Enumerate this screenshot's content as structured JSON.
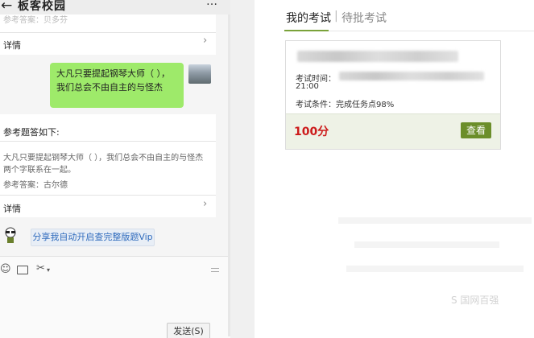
{
  "chat": {
    "back_icon": "←",
    "title": "板客校园",
    "more_icon": "…",
    "top_reference_faded": "参考答案：贝多芬",
    "details_label_1": "详情",
    "chevron_icon": "›",
    "bubble_text": "大凡只要提起钢琴大师（ ），我们总会不由自主的与怪杰",
    "reference_heading": "参考题答如下:",
    "question_text": "大凡只要提起钢琴大师（ ），我们总会不由自主的与怪杰两个字联系在一起。",
    "reference_answer": "参考答案：古尔德",
    "details_label_2": "详情",
    "share_label": "分享我自动开启查完整版题Vip",
    "toolbar_icons": [
      "☺",
      "🗀",
      "✂"
    ],
    "send_label": "发送(S)"
  },
  "exam": {
    "tab_active": "我的考试",
    "tab_separator": "|",
    "tab_inactive": "待批考试",
    "time_label": "考试时间：",
    "time_value": "21:00",
    "condition": "考试条件：完成任务点98%",
    "score": "100分",
    "view_button": "查看",
    "accent_color": "#6b8e2a",
    "score_color": "#cc1a1a"
  },
  "watermark": "S 国网百强"
}
